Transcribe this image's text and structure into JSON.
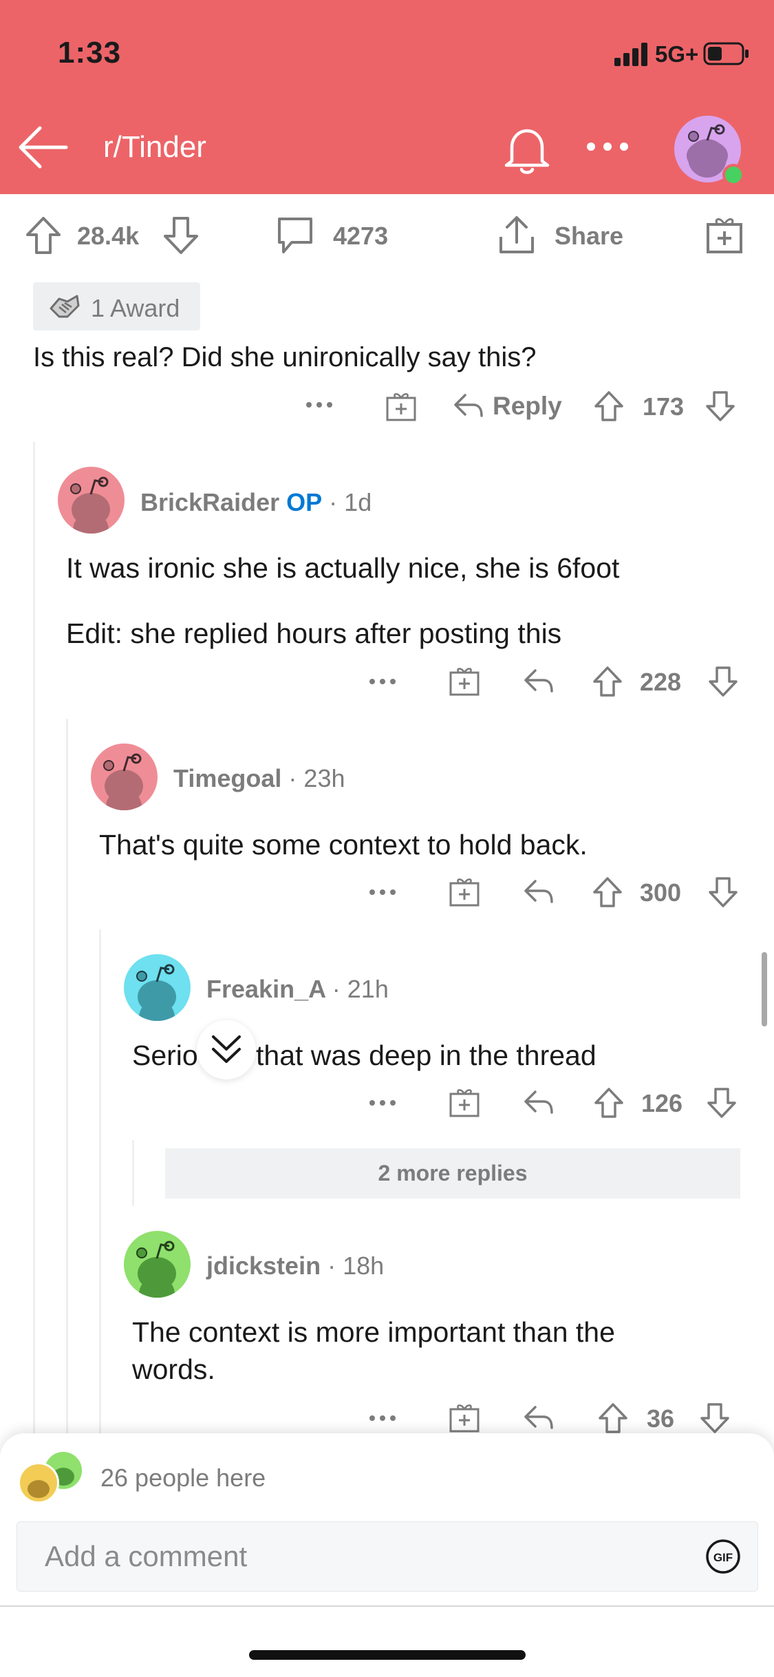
{
  "status": {
    "time": "1:33",
    "network": "5G+"
  },
  "header": {
    "subreddit": "r/Tinder"
  },
  "post_actions": {
    "upvotes": "28.4k",
    "comments": "4273",
    "share": "Share"
  },
  "top_comment": {
    "award": "1 Award",
    "text": "Is this real? Did she unironically say this?",
    "reply": "Reply",
    "votes": "173"
  },
  "comments": [
    {
      "user": "BrickRaider",
      "flair": "OP",
      "time": "1d",
      "line1": "It was ironic she is actually nice, she is 6foot",
      "line2": "Edit: she replied hours after posting this",
      "votes": "228",
      "avatar_color": "#ef8d96"
    },
    {
      "user": "Timegoal",
      "time": "23h",
      "line1": "That's quite some context to hold back.",
      "votes": "300",
      "avatar_color": "#ef8d96"
    },
    {
      "user": "Freakin_A",
      "time": "21h",
      "line1": "Seriously that was deep in the thread",
      "votes": "126",
      "avatar_color": "#6ee0ef"
    },
    {
      "user": "jdickstein",
      "time": "18h",
      "line1": "The context is more important than the",
      "line2": "words.",
      "votes": "36",
      "avatar_color": "#8fe06c"
    }
  ],
  "more_replies": "2 more replies",
  "bottom": {
    "people": "26 people here",
    "placeholder": "Add a comment",
    "gif": "GIF"
  },
  "separator": "·",
  "colors": {
    "brand": "#ec6468",
    "op": "#0079d3",
    "meta": "#7c7c7c"
  }
}
